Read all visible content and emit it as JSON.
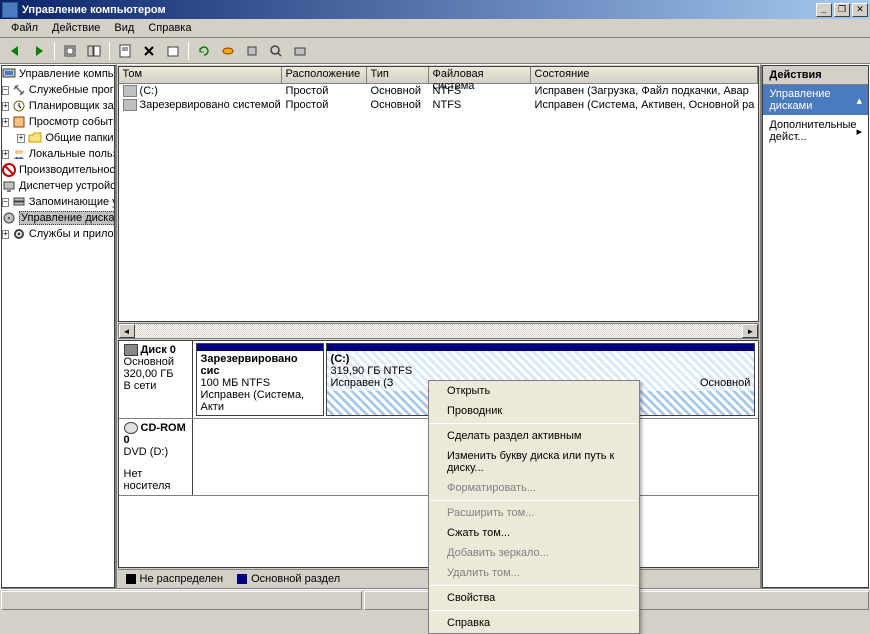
{
  "title": "Управление компьютером",
  "menu": [
    "Файл",
    "Действие",
    "Вид",
    "Справка"
  ],
  "tree": {
    "root": "Управление компьютером (лока",
    "group1": "Служебные программы",
    "items1": [
      "Планировщик заданий",
      "Просмотр событий",
      "Общие папки",
      "Локальные пользовател",
      "Производительность",
      "Диспетчер устройств"
    ],
    "group2": "Запоминающие устройства",
    "selected": "Управление дисками",
    "group3": "Службы и приложения"
  },
  "cols": {
    "c1": "Том",
    "c2": "Расположение",
    "c3": "Тип",
    "c4": "Файловая система",
    "c5": "Состояние"
  },
  "rows": [
    {
      "name": "(C:)",
      "layout": "Простой",
      "type": "Основной",
      "fs": "NTFS",
      "status": "Исправен (Загрузка, Файл подкачки, Авар"
    },
    {
      "name": "Зарезервировано системой",
      "layout": "Простой",
      "type": "Основной",
      "fs": "NTFS",
      "status": "Исправен (Система, Активен, Основной ра"
    }
  ],
  "disks": {
    "d0": {
      "name": "Диск 0",
      "type": "Основной",
      "size": "320,00 ГБ",
      "state": "В сети"
    },
    "p1": {
      "name": "Зарезервировано сис",
      "info": "100 МБ NTFS",
      "status": "Исправен (Система, Акти"
    },
    "p2": {
      "name": "(C:)",
      "info": "319,90 ГБ NTFS",
      "status": "Исправен (З",
      "extra": "Основной"
    },
    "d1": {
      "name": "CD-ROM 0",
      "type": "DVD (D:)",
      "state": "Нет носителя"
    }
  },
  "legend": {
    "l1": "Не распределен",
    "l2": "Основной раздел"
  },
  "actions": {
    "header": "Действия",
    "title": "Управление дисками",
    "more": "Дополнительные дейст..."
  },
  "ctx": {
    "open": "Открыть",
    "explorer": "Проводник",
    "active": "Сделать раздел активным",
    "letter": "Изменить букву диска или путь к диску...",
    "format": "Форматировать...",
    "extend": "Расширить том...",
    "shrink": "Сжать том...",
    "mirror": "Добавить зеркало...",
    "delete": "Удалить том...",
    "props": "Свойства",
    "help": "Справка"
  }
}
